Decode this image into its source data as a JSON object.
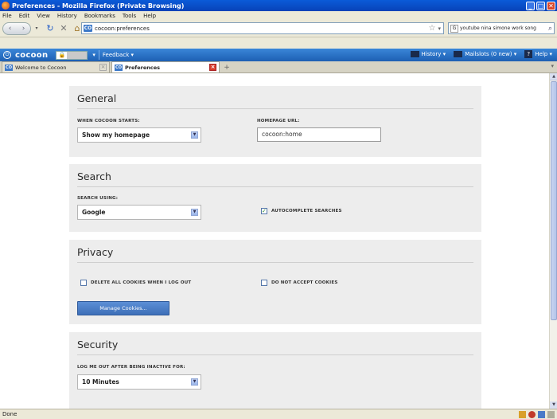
{
  "window": {
    "title": "Preferences - Mozilla Firefox (Private Browsing)",
    "controls": {
      "minimize": "_",
      "maximize": "□",
      "close": "✕"
    }
  },
  "menubar": {
    "items": [
      "File",
      "Edit",
      "View",
      "History",
      "Bookmarks",
      "Tools",
      "Help"
    ]
  },
  "navbar": {
    "url": "cocoon:preferences",
    "site_badge": "CO",
    "search_value": "youtube nina simone work song",
    "search_engine_badge": "G"
  },
  "cocoonbar": {
    "brand": "cocoon",
    "feedback": "Feedback",
    "history": "History",
    "mailslots": "Mailslots (0 new)",
    "help": "Help"
  },
  "tabs": [
    {
      "label": "Welcome to Cocoon",
      "badge": "CO",
      "active": false
    },
    {
      "label": "Preferences",
      "badge": "CO",
      "active": true
    }
  ],
  "sections": {
    "general": {
      "title": "General",
      "startup_label": "WHEN COCOON STARTS:",
      "startup_value": "Show my homepage",
      "homepage_label": "HOMEPAGE URL:",
      "homepage_value": "cocoon:home"
    },
    "search": {
      "title": "Search",
      "engine_label": "SEARCH USING:",
      "engine_value": "Google",
      "autocomplete_label": "AUTOCOMPLETE SEARCHES",
      "autocomplete_checked": true
    },
    "privacy": {
      "title": "Privacy",
      "delete_cookies_label": "DELETE ALL COOKIES WHEN I LOG OUT",
      "delete_cookies_checked": false,
      "no_cookies_label": "DO NOT ACCEPT COOKIES",
      "no_cookies_checked": false,
      "manage_button": "Manage Cookies..."
    },
    "security": {
      "title": "Security",
      "timeout_label": "LOG ME OUT AFTER BEING INACTIVE FOR:",
      "timeout_value": "10 Minutes"
    }
  },
  "statusbar": {
    "text": "Done"
  },
  "colors": {
    "titlebar": "#0842b8",
    "cocoonbar": "#1d5fb3",
    "section_bg": "#ededed",
    "button": "#3d6fb8"
  }
}
